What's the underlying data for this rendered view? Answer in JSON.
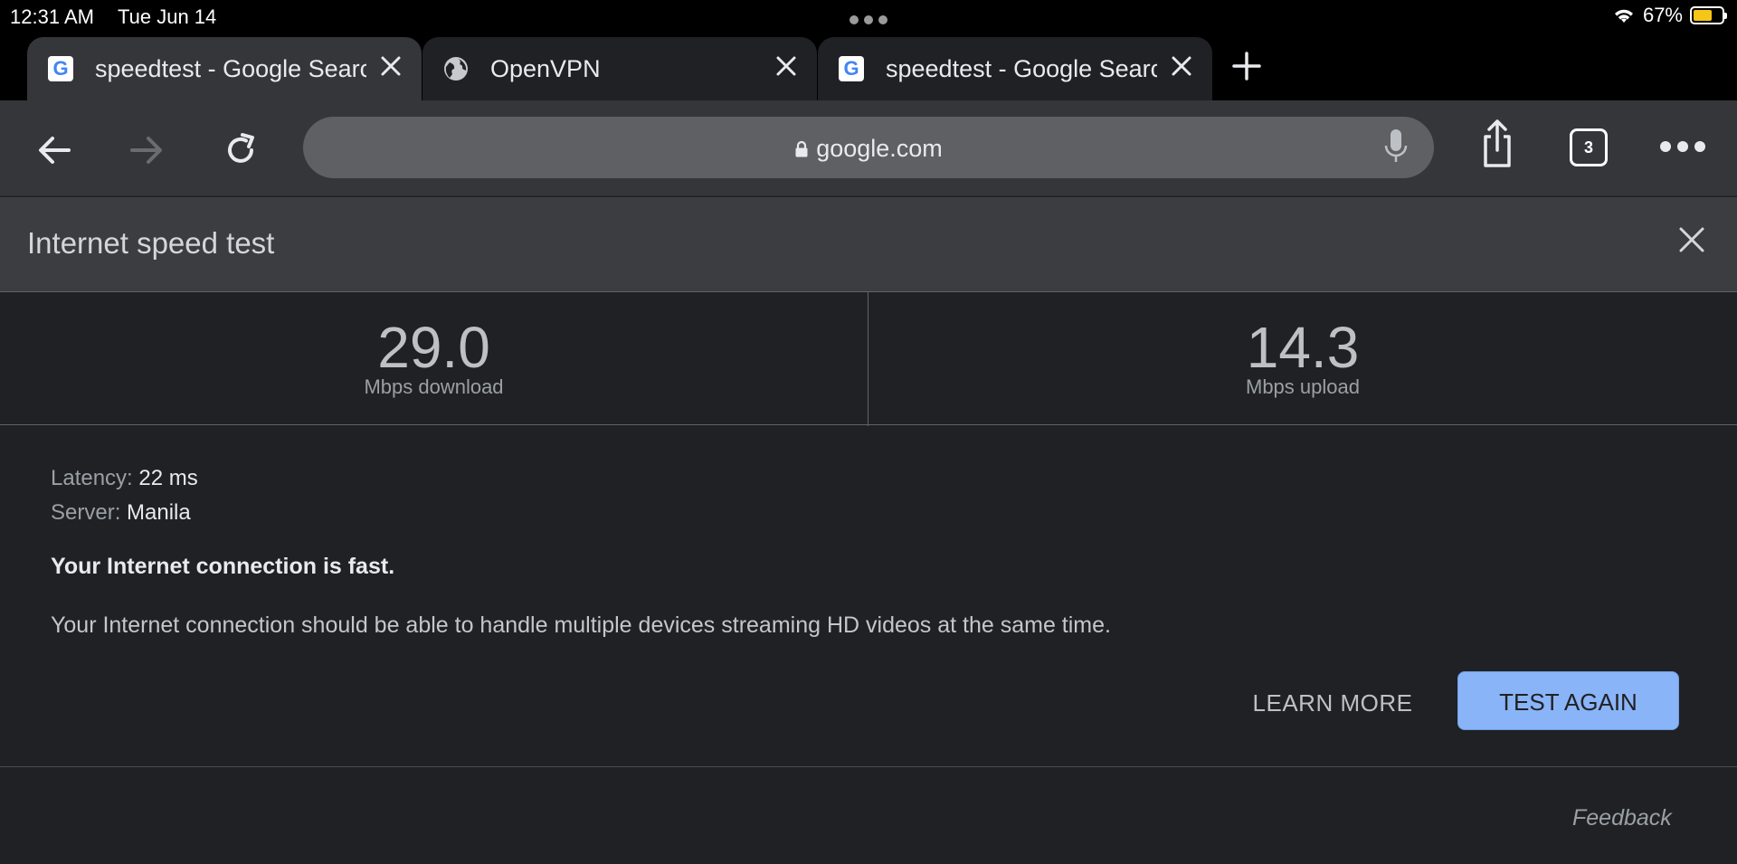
{
  "status_bar": {
    "time": "12:31 AM",
    "date": "Tue Jun 14",
    "battery_percent": "67%",
    "battery_level": 0.67
  },
  "tabs": [
    {
      "title": "speedtest - Google Search",
      "favicon": "google-g-icon",
      "active": true
    },
    {
      "title": "OpenVPN",
      "favicon": "globe-icon",
      "active": false
    },
    {
      "title": "speedtest - Google Search",
      "favicon": "google-g-icon",
      "active": false
    }
  ],
  "toolbar": {
    "url": "google.com",
    "tab_count": "3"
  },
  "speedtest": {
    "title": "Internet speed test",
    "download_value": "29.0",
    "download_label": "Mbps download",
    "upload_value": "14.3",
    "upload_label": "Mbps upload",
    "latency_key": "Latency:",
    "latency_value": "22 ms",
    "server_key": "Server:",
    "server_value": "Manila",
    "headline": "Your Internet connection is fast.",
    "description": "Your Internet connection should be able to handle multiple devices streaming HD videos at the same time.",
    "learn_more": "LEARN MORE",
    "test_again": "TEST AGAIN",
    "feedback": "Feedback"
  },
  "colors": {
    "accent_button": "#8ab4f8",
    "battery": "#f5c518",
    "background": "#202124"
  }
}
